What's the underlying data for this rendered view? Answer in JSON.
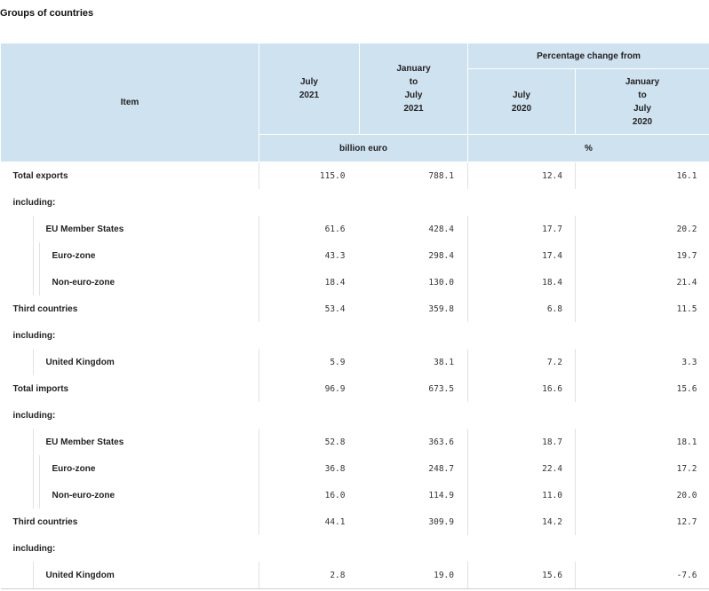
{
  "caption": "Groups of countries",
  "header": {
    "item": "Item",
    "col_july_2021": "July\n2021",
    "col_jan_jul_2021": "January\nto\nJuly\n2021",
    "pct_change": "Percentage change from",
    "col_july_2020": "July\n2020",
    "col_jan_jul_2020": "January\nto\nJuly\n2020",
    "unit_billion": "billion euro",
    "unit_pct": "%"
  },
  "rows": [
    {
      "label": "Total exports",
      "level": 0,
      "v": [
        "115.0",
        "788.1",
        "12.4",
        "16.1"
      ]
    },
    {
      "label": "including:",
      "level": 0,
      "v": [
        "",
        "",
        "",
        ""
      ]
    },
    {
      "label": "EU Member States",
      "level": 1,
      "v": [
        "61.6",
        "428.4",
        "17.7",
        "20.2"
      ]
    },
    {
      "label": "Euro-zone",
      "level": 2,
      "v": [
        "43.3",
        "298.4",
        "17.4",
        "19.7"
      ]
    },
    {
      "label": "Non-euro-zone",
      "level": 2,
      "v": [
        "18.4",
        "130.0",
        "18.4",
        "21.4"
      ]
    },
    {
      "label": "Third countries",
      "level": 0,
      "v": [
        "53.4",
        "359.8",
        "6.8",
        "11.5"
      ]
    },
    {
      "label": "including:",
      "level": 0,
      "v": [
        "",
        "",
        "",
        ""
      ]
    },
    {
      "label": "United Kingdom",
      "level": 1,
      "v": [
        "5.9",
        "38.1",
        "7.2",
        "3.3"
      ]
    },
    {
      "label": "Total imports",
      "level": 0,
      "v": [
        "96.9",
        "673.5",
        "16.6",
        "15.6"
      ]
    },
    {
      "label": "including:",
      "level": 0,
      "v": [
        "",
        "",
        "",
        ""
      ]
    },
    {
      "label": "EU Member States",
      "level": 1,
      "v": [
        "52.8",
        "363.6",
        "18.7",
        "18.1"
      ]
    },
    {
      "label": "Euro-zone",
      "level": 2,
      "v": [
        "36.8",
        "248.7",
        "22.4",
        "17.2"
      ]
    },
    {
      "label": "Non-euro-zone",
      "level": 2,
      "v": [
        "16.0",
        "114.9",
        "11.0",
        "20.0"
      ]
    },
    {
      "label": "Third countries",
      "level": 0,
      "v": [
        "44.1",
        "309.9",
        "14.2",
        "12.7"
      ]
    },
    {
      "label": "including:",
      "level": 0,
      "v": [
        "",
        "",
        "",
        ""
      ]
    },
    {
      "label": "United Kingdom",
      "level": 1,
      "v": [
        "2.8",
        "19.0",
        "15.6",
        "-7.6"
      ]
    }
  ]
}
